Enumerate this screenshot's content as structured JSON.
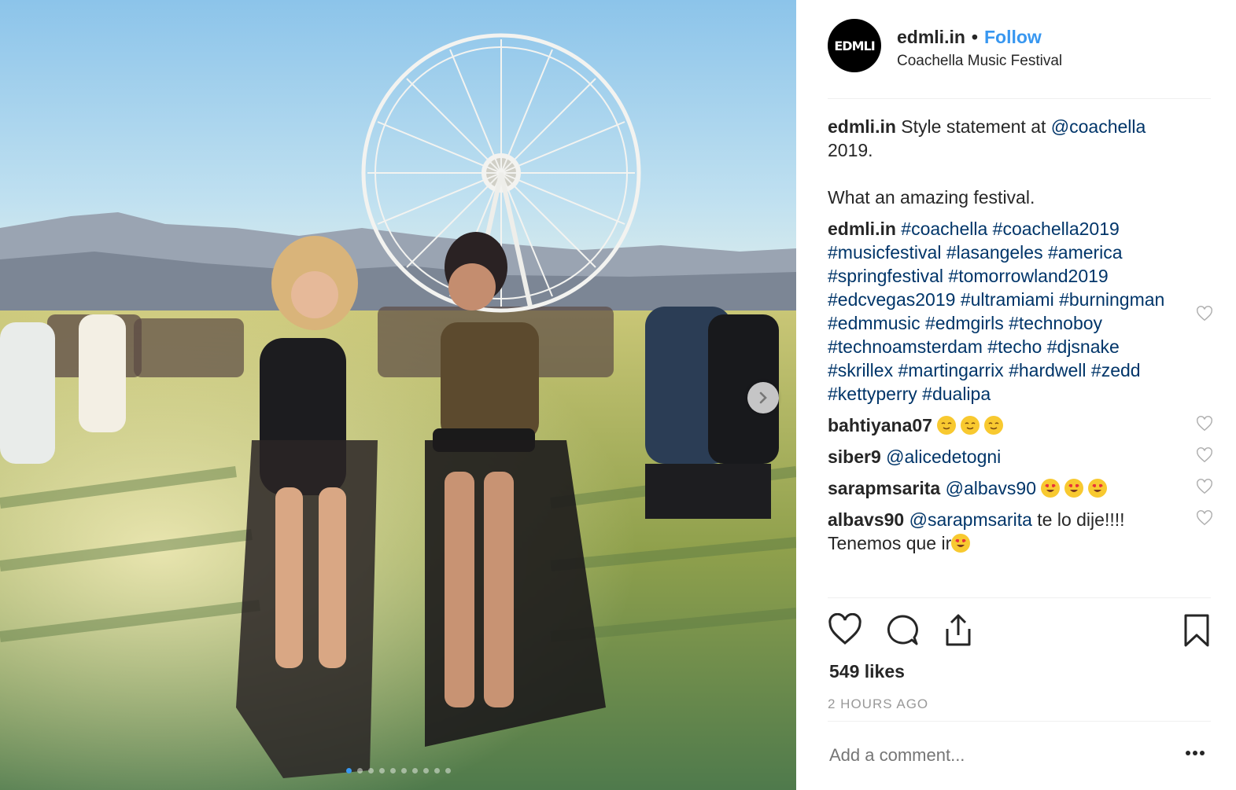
{
  "post": {
    "username": "edmli.in",
    "separator": "•",
    "follow_label": "Follow",
    "location": "Coachella Music Festival",
    "avatar_text": "EDMLI"
  },
  "caption": {
    "author": "edmli.in",
    "text_before": "Style statement at ",
    "mention": "@coachella",
    "text_after": " 2019.",
    "line2": "What an amazing festival."
  },
  "hashtag_comment": {
    "author": "edmli.in",
    "tags": [
      "#coachella",
      "#coachella2019",
      "#musicfestival",
      "#lasangeles",
      "#america",
      "#springfestival",
      "#tomorrowland2019",
      "#edcvegas2019",
      "#ultramiami",
      "#burningman",
      "#edmmusic",
      "#edmgirls",
      "#technoboy",
      "#technoamsterdam",
      "#techo",
      "#djsnake",
      "#skrillex",
      "#martingarrix",
      "#hardwell",
      "#zedd",
      "#kettyperry",
      "#dualipa"
    ]
  },
  "comments": [
    {
      "user": "bahtiyana07",
      "mention": "",
      "text": "",
      "emoji": "relieved-face",
      "emoji_count": 3
    },
    {
      "user": "siber9",
      "mention": "@alicedetogni",
      "text": "",
      "emoji": "",
      "emoji_count": 0
    },
    {
      "user": "sarapmsarita",
      "mention": "@albavs90",
      "text": "",
      "emoji": "heart-eyes-face",
      "emoji_count": 3
    },
    {
      "user": "albavs90",
      "mention": "@sarapmsarita",
      "text": " te lo dije!!!! Tenemos que ir",
      "emoji": "heart-eyes-face",
      "emoji_count": 1
    }
  ],
  "likes_text": "549 likes",
  "time_ago": "2 HOURS AGO",
  "add_comment_placeholder": "Add a comment...",
  "carousel": {
    "slides": 10,
    "active_index": 0
  },
  "colors": {
    "link": "#003569",
    "accent": "#3897f0",
    "muted": "#999999"
  }
}
